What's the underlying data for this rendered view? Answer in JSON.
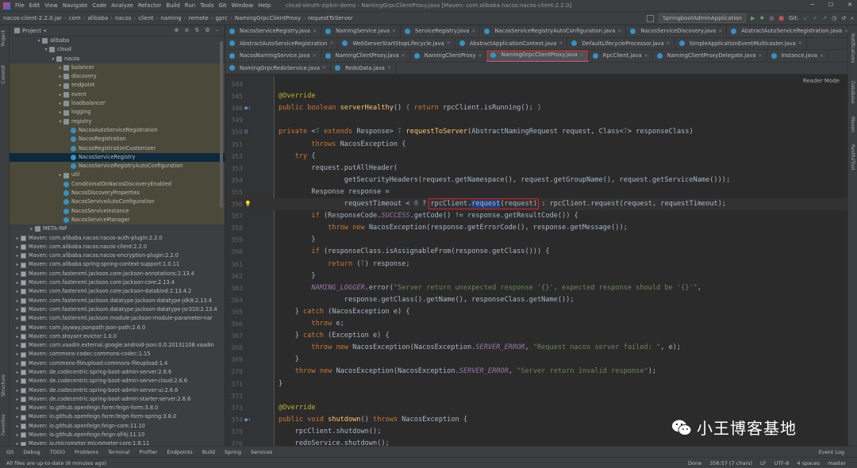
{
  "menubar": {
    "items": [
      "File",
      "Edit",
      "View",
      "Navigate",
      "Code",
      "Analyze",
      "Refactor",
      "Build",
      "Run",
      "Tools",
      "Git",
      "Window",
      "Help"
    ],
    "window_title": "cloud-sleuth-zipkin-demo - NamingGrpcClientProxy.java [Maven: com.alibaba.nacos:nacos-client:2.2.0]"
  },
  "navbar": {
    "crumbs": [
      "nacos-client-2.2.0.jar",
      "com",
      "alibaba",
      "nacos",
      "client",
      "naming",
      "remote",
      "gprc",
      "NamingGrpcClientProxy",
      "requestToServer"
    ],
    "run_config": "SpringbootAdminApplication",
    "git_label": "Git:"
  },
  "project": {
    "title": "Project",
    "tree": [
      {
        "label": "alibaba",
        "depth": 3,
        "type": "folder",
        "arrow": "▾"
      },
      {
        "label": "cloud",
        "depth": 4,
        "type": "folder",
        "arrow": "▾"
      },
      {
        "label": "nacos",
        "depth": 5,
        "type": "folder",
        "arrow": "▾"
      },
      {
        "label": "balancer",
        "depth": 6,
        "type": "folder",
        "arrow": "▸"
      },
      {
        "label": "discovery",
        "depth": 6,
        "type": "folder",
        "arrow": "▸"
      },
      {
        "label": "endpoint",
        "depth": 6,
        "type": "folder",
        "arrow": "▸"
      },
      {
        "label": "event",
        "depth": 6,
        "type": "folder",
        "arrow": "▸"
      },
      {
        "label": "loadbalancer",
        "depth": 6,
        "type": "folder",
        "arrow": "▸"
      },
      {
        "label": "logging",
        "depth": 6,
        "type": "folder",
        "arrow": "▸"
      },
      {
        "label": "registry",
        "depth": 6,
        "type": "folder",
        "arrow": "▾"
      },
      {
        "label": "NacosAutoServiceRegistration",
        "depth": 7,
        "type": "class"
      },
      {
        "label": "NacosRegistration",
        "depth": 7,
        "type": "class"
      },
      {
        "label": "NacosRegistrationCustomizer",
        "depth": 7,
        "type": "class"
      },
      {
        "label": "NacosServiceRegistry",
        "depth": 7,
        "type": "class",
        "selected": true
      },
      {
        "label": "NacosServiceRegistryAutoConfiguration",
        "depth": 7,
        "type": "class"
      },
      {
        "label": "util",
        "depth": 6,
        "type": "folder",
        "arrow": "▸"
      },
      {
        "label": "ConditionalOnNacosDiscoveryEnabled",
        "depth": 6,
        "type": "class"
      },
      {
        "label": "NacosDiscoveryProperties",
        "depth": 6,
        "type": "class"
      },
      {
        "label": "NacosServiceAutoConfiguration",
        "depth": 6,
        "type": "class"
      },
      {
        "label": "NacosServiceInstance",
        "depth": 6,
        "type": "class"
      },
      {
        "label": "NacosServiceManager",
        "depth": 6,
        "type": "class"
      },
      {
        "label": "META-INF",
        "depth": 2,
        "type": "folder",
        "arrow": "▸"
      },
      {
        "label": "Maven: com.alibaba.nacos:nacos-auth-plugin:2.2.0",
        "depth": 0,
        "type": "lib",
        "arrow": "▸"
      },
      {
        "label": "Maven: com.alibaba.nacos:nacos-client:2.2.0",
        "depth": 0,
        "type": "lib",
        "arrow": "▸"
      },
      {
        "label": "Maven: com.alibaba.nacos:nacos-encryption-plugin:2.2.0",
        "depth": 0,
        "type": "lib",
        "arrow": "▸"
      },
      {
        "label": "Maven: com.alibaba.spring:spring-context-support:1.0.11",
        "depth": 0,
        "type": "lib",
        "arrow": "▸"
      },
      {
        "label": "Maven: com.fasterxml.jackson.core:jackson-annotations:2.13.4",
        "depth": 0,
        "type": "lib",
        "arrow": "▸"
      },
      {
        "label": "Maven: com.fasterxml.jackson.core:jackson-core:2.13.4",
        "depth": 0,
        "type": "lib",
        "arrow": "▸"
      },
      {
        "label": "Maven: com.fasterxml.jackson.core:jackson-databind:2.13.4.2",
        "depth": 0,
        "type": "lib",
        "arrow": "▸"
      },
      {
        "label": "Maven: com.fasterxml.jackson.datatype:jackson-datatype-jdk8:2.13.4",
        "depth": 0,
        "type": "lib",
        "arrow": "▸"
      },
      {
        "label": "Maven: com.fasterxml.jackson.datatype:jackson-datatype-jsr310:2.13.4",
        "depth": 0,
        "type": "lib",
        "arrow": "▸"
      },
      {
        "label": "Maven: com.fasterxml.jackson.module:jackson-module-parameter-nar",
        "depth": 0,
        "type": "lib",
        "arrow": "▸"
      },
      {
        "label": "Maven: com.jayway.jsonpath:json-path:2.6.0",
        "depth": 0,
        "type": "lib",
        "arrow": "▸"
      },
      {
        "label": "Maven: com.stoyanr:evictor:1.0.0",
        "depth": 0,
        "type": "lib",
        "arrow": "▸"
      },
      {
        "label": "Maven: com.vaadin.external.google:android-json:0.0.20131108.vaadin",
        "depth": 0,
        "type": "lib",
        "arrow": "▸"
      },
      {
        "label": "Maven: commons-codec:commons-codec:1.15",
        "depth": 0,
        "type": "lib",
        "arrow": "▸"
      },
      {
        "label": "Maven: commons-fileupload:commons-fileupload:1.4",
        "depth": 0,
        "type": "lib",
        "arrow": "▸"
      },
      {
        "label": "Maven: de.codecentric:spring-boot-admin-server:2.6.6",
        "depth": 0,
        "type": "lib",
        "arrow": "▸"
      },
      {
        "label": "Maven: de.codecentric:spring-boot-admin-server-cloud:2.6.6",
        "depth": 0,
        "type": "lib",
        "arrow": "▸"
      },
      {
        "label": "Maven: de.codecentric:spring-boot-admin-server-ui:2.6.6",
        "depth": 0,
        "type": "lib",
        "arrow": "▸"
      },
      {
        "label": "Maven: de.codecentric:spring-boot-admin-starter-server:2.6.6",
        "depth": 0,
        "type": "lib",
        "arrow": "▸"
      },
      {
        "label": "Maven: io.github.openfeign.form:feign-form:3.8.0",
        "depth": 0,
        "type": "lib",
        "arrow": "▸"
      },
      {
        "label": "Maven: io.github.openfeign.form:feign-form-spring:3.8.0",
        "depth": 0,
        "type": "lib",
        "arrow": "▸"
      },
      {
        "label": "Maven: io.github.openfeign:feign-core:11.10",
        "depth": 0,
        "type": "lib",
        "arrow": "▸"
      },
      {
        "label": "Maven: io.github.openfeign:feign-slf4j:11.10",
        "depth": 0,
        "type": "lib",
        "arrow": "▸"
      },
      {
        "label": "Maven: io.micrometer:micrometer-core:1.8.11",
        "depth": 0,
        "type": "lib",
        "arrow": "▸"
      }
    ]
  },
  "left_strip": [
    "Project",
    "Commit",
    "Structure",
    "Favorites"
  ],
  "right_strip": [
    "Notifications",
    "Database",
    "Maven",
    "RestfulTool"
  ],
  "tabs": [
    [
      {
        "label": "NacosServiceRegistry.java"
      },
      {
        "label": "NamingService.java"
      },
      {
        "label": "ServiceRegistry.java"
      },
      {
        "label": "NacosServiceRegistryAutoConfiguration.java"
      },
      {
        "label": "NacosServiceDiscovery.java"
      },
      {
        "label": "AbstractAutoServiceRegistration.java"
      }
    ],
    [
      {
        "label": "AbstractAutoServiceRegistration"
      },
      {
        "label": "WebServerStartStopLifecycle.java"
      },
      {
        "label": "AbstractApplicationContext.java"
      },
      {
        "label": "DefaultLifecycleProcessor.java"
      },
      {
        "label": "SimpleApplicationEventMulticaster.java"
      }
    ],
    [
      {
        "label": "NacosNamingService.java"
      },
      {
        "label": "NamingClientProxy.java"
      },
      {
        "label": "NamingClientProxy"
      },
      {
        "label": "NamingGrpcClientProxy.java",
        "active": true
      },
      {
        "label": "RpcClient.java"
      },
      {
        "label": "NamingClientProxyDelegate.java"
      },
      {
        "label": "Instance.java"
      }
    ],
    [
      {
        "label": "NamingGrpcRedoService.java"
      },
      {
        "label": "RedoData.java"
      }
    ]
  ],
  "reader_mode": "Reader Mode",
  "code": [
    {
      "n": "344",
      "html": ""
    },
    {
      "n": "345",
      "html": "<span class='an'>@Override</span>"
    },
    {
      "n": "346",
      "html": "<span class='kw'>public boolean </span><span class='fn'>serverHealthy</span>() <span class='gr'>{</span> <span class='kw'>return </span><span class='pa'>rpcClient</span>.isRunning(); <span class='gr'>}</span>",
      "gi": "●↑"
    },
    {
      "n": "349",
      "html": ""
    },
    {
      "n": "350",
      "html": "<span class='kw'>private </span>&lt;<span class='tp'>T</span> <span class='kw'>extends </span>Response&gt; <span class='tp'>T</span> <span class='fn'>requestToServer</span>(AbstractNamingRequest request, Class&lt;<span class='tp'>T</span>&gt; responseClass)",
      "gi": "@"
    },
    {
      "n": "351",
      "html": "        <span class='kw'>throws </span>NacosException {"
    },
    {
      "n": "352",
      "html": "    <span class='kw'>try </span>{"
    },
    {
      "n": "353",
      "html": "        request.putAllHeader("
    },
    {
      "n": "354",
      "html": "                getSecurityHeaders(request.getNamespace(), request.getGroupName(), request.getServiceName()));"
    },
    {
      "n": "355",
      "html": "        Response response ="
    },
    {
      "n": "356",
      "html": "                <span class='pa'>requestTimeout</span> &lt; <span class='nm'>0</span> ? <span class='boxed-code'><span class='pa'>rpcClient</span>.<span class='selw'>request</span>(request)</span> : <span class='pa'>rpcClient</span>.request(request, <span class='pa'>requestTimeout</span>);",
      "gi": "💡",
      "cur": true
    },
    {
      "n": "357",
      "html": "        <span class='kw'>if </span>(ResponseCode.<span class='cn'>SUCCESS</span>.getCode() != response.getResultCode()) {"
    },
    {
      "n": "358",
      "html": "            <span class='kw'>throw new </span>NacosException(response.getErrorCode(), response.getMessage());"
    },
    {
      "n": "359",
      "html": "        }"
    },
    {
      "n": "360",
      "html": "        <span class='kw'>if </span>(responseClass.isAssignableFrom(response.getClass())) {"
    },
    {
      "n": "361",
      "html": "            <span class='kw'>return </span>(<span class='tp'>T</span>) response;"
    },
    {
      "n": "362",
      "html": "        }"
    },
    {
      "n": "363",
      "html": "        <span class='cn'>NAMING_LOGGER</span>.error(<span class='st'>\"Server return unexpected response '{}', expected response should be '{}'\"</span>,"
    },
    {
      "n": "364",
      "html": "                response.getClass().getName(), responseClass.getName());"
    },
    {
      "n": "365",
      "html": "    } <span class='kw'>catch </span>(NacosException e) {"
    },
    {
      "n": "366",
      "html": "        <span class='kw'>throw </span>e;"
    },
    {
      "n": "367",
      "html": "    } <span class='kw'>catch </span>(Exception e) {"
    },
    {
      "n": "368",
      "html": "        <span class='kw'>throw new </span>NacosException(NacosException.<span class='cn'>SERVER_ERROR</span>, <span class='st'>\"Request nacos server failed: \"</span>, e);"
    },
    {
      "n": "369",
      "html": "    }"
    },
    {
      "n": "370",
      "html": "    <span class='kw'>throw new </span>NacosException(NacosException.<span class='cn'>SERVER_ERROR</span>, <span class='st'>\"Server return invalid response\"</span>);"
    },
    {
      "n": "371",
      "html": "}"
    },
    {
      "n": "372",
      "html": ""
    },
    {
      "n": "373",
      "html": "<span class='an'>@Override</span>"
    },
    {
      "n": "374",
      "html": "<span class='kw'>public void </span><span class='fn'>shutdown</span>() <span class='kw'>throws </span>NacosException {",
      "gi": "●↑"
    },
    {
      "n": "375",
      "html": "    <span class='pa'>rpcClient</span>.shutdown();"
    },
    {
      "n": "376",
      "html": "    <span class='pa'>redoService</span>.shutdown();"
    }
  ],
  "bottom_tools": [
    "Git",
    "Debug",
    "TODO",
    "Problems",
    "Terminal",
    "Profiler",
    "Endpoints",
    "Build",
    "Spring",
    "Services"
  ],
  "event_log": "Event Log",
  "status": {
    "left": "All files are up-to-date (8 minutes ago)",
    "right": [
      "Done",
      "356:57 (7 chars)",
      "LF",
      "UTF-8",
      "4 spaces",
      "master"
    ]
  },
  "watermark": "小王博客基地",
  "colors": {
    "accent": "#4a88c7",
    "highlight_box": "#e02020"
  }
}
